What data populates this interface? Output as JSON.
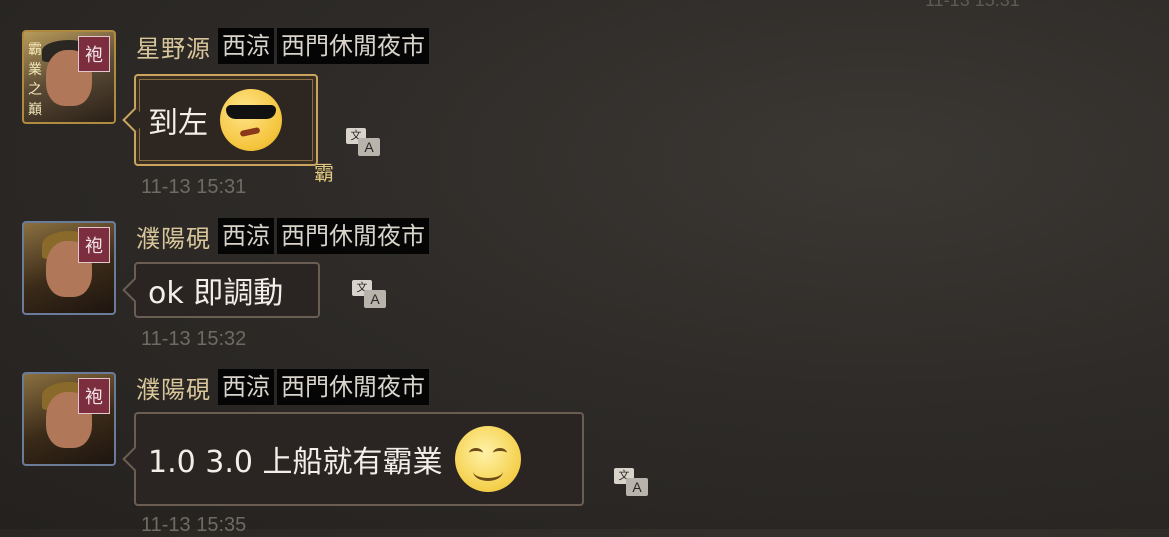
{
  "top_timestamp": "11-13 15:31",
  "messages": [
    {
      "user": "星野源",
      "tags": [
        "西涼",
        "西門休閒夜市"
      ],
      "avatar_badge": "袍",
      "avatar_side_text": "霸業之巔",
      "text": "到左",
      "emoji": "cool-sunglasses-emoji",
      "bubble_corner": "霸",
      "time": "11-13 15:31"
    },
    {
      "user": "濮陽硯",
      "tags": [
        "西涼",
        "西門休閒夜市"
      ],
      "avatar_badge": "袍",
      "text": "ok 即調動",
      "time": "11-13 15:32"
    },
    {
      "user": "濮陽硯",
      "tags": [
        "西涼",
        "西門休閒夜市"
      ],
      "avatar_badge": "袍",
      "text": "1.0 3.0 上船就有霸業",
      "emoji": "smile-emoji",
      "time": "11-13 15:35"
    }
  ],
  "translate_icon": {
    "glyph_a": "文",
    "glyph_b": "A"
  }
}
